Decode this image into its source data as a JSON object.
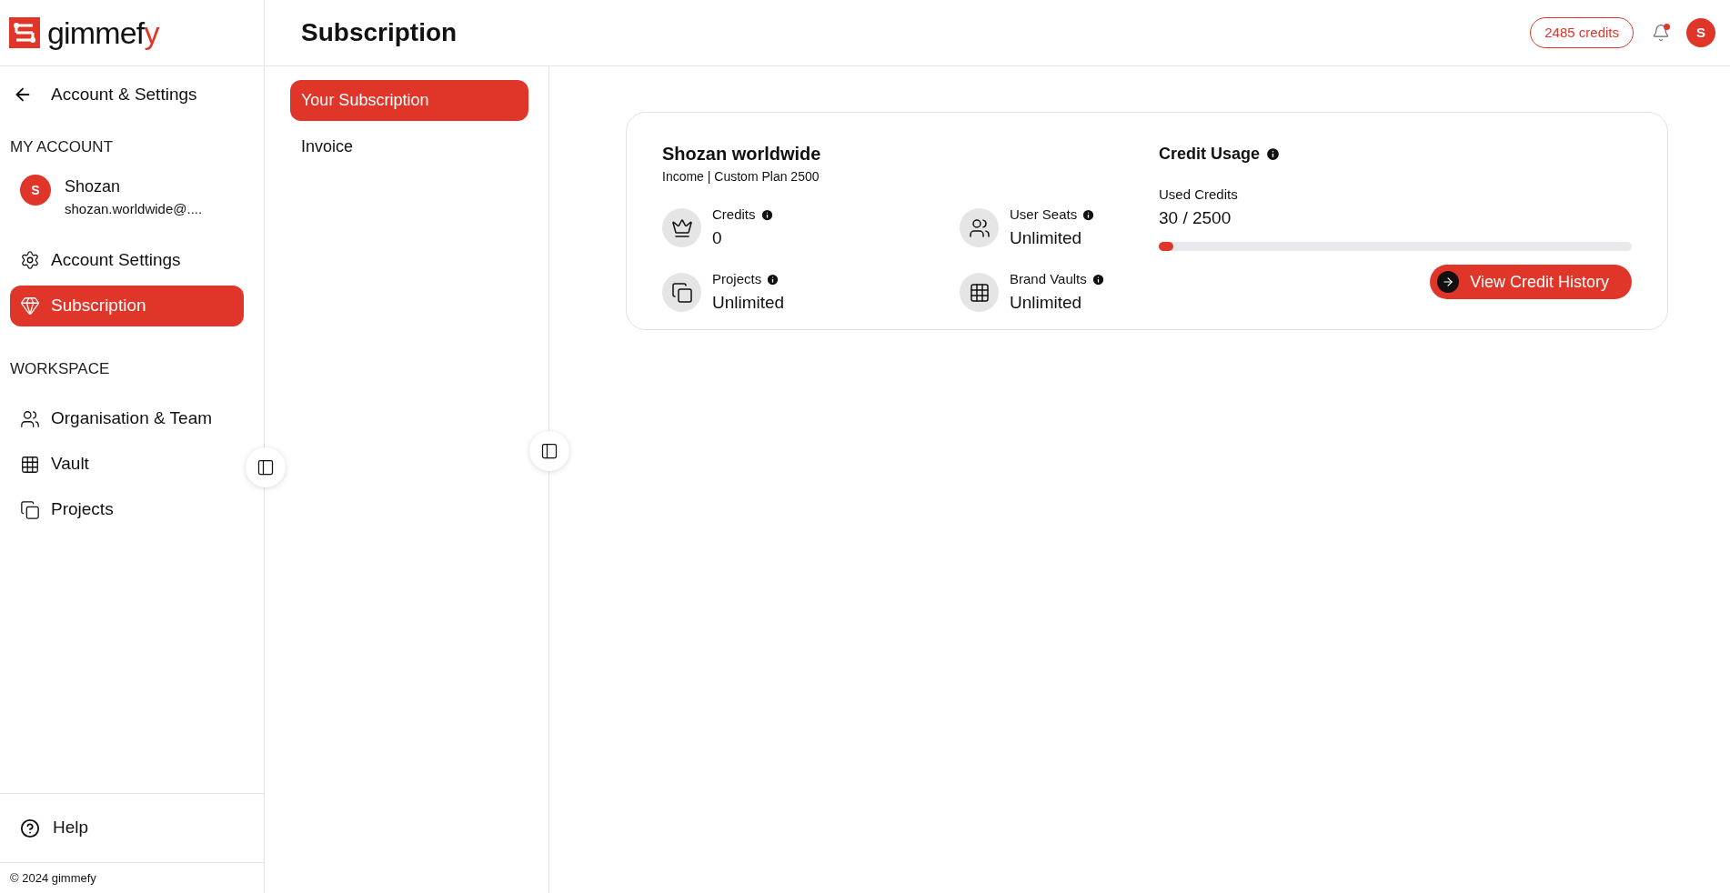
{
  "logo": {
    "text": "gimmef",
    "accent": "y"
  },
  "header": {
    "title": "Subscription",
    "credits_badge": "2485 credits",
    "notification_unread": true,
    "avatar": "S"
  },
  "sidebar": {
    "back_label": "Account & Settings",
    "sections": [
      {
        "heading": "MY ACCOUNT",
        "user": {
          "avatar": "S",
          "name": "Shozan",
          "email": "shozan.worldwide@...."
        },
        "items": [
          {
            "label": "Account Settings",
            "selected": false
          },
          {
            "label": "Subscription",
            "selected": true
          }
        ]
      },
      {
        "heading": "WORKSPACE",
        "items": [
          {
            "label": "Organisation & Team",
            "selected": false
          },
          {
            "label": "Vault",
            "selected": false
          },
          {
            "label": "Projects",
            "selected": false
          }
        ]
      }
    ],
    "help": "Help",
    "footer": "© 2024 gimmefy"
  },
  "subnav": [
    {
      "label": "Your Subscription",
      "selected": true
    },
    {
      "label": "Invoice",
      "selected": false
    }
  ],
  "card": {
    "org_name": "Shozan worldwide",
    "plan": "Income | Custom Plan 2500",
    "stats": [
      {
        "label": "Credits",
        "value": "0"
      },
      {
        "label": "User Seats",
        "value": "Unlimited"
      },
      {
        "label": "Projects",
        "value": "Unlimited"
      },
      {
        "label": "Brand Vaults",
        "value": "Unlimited"
      }
    ],
    "usage": {
      "title": "Credit Usage",
      "label": "Used Credits",
      "reading": "30 / 2500",
      "level": 0.012,
      "button": "View Credit History"
    }
  }
}
